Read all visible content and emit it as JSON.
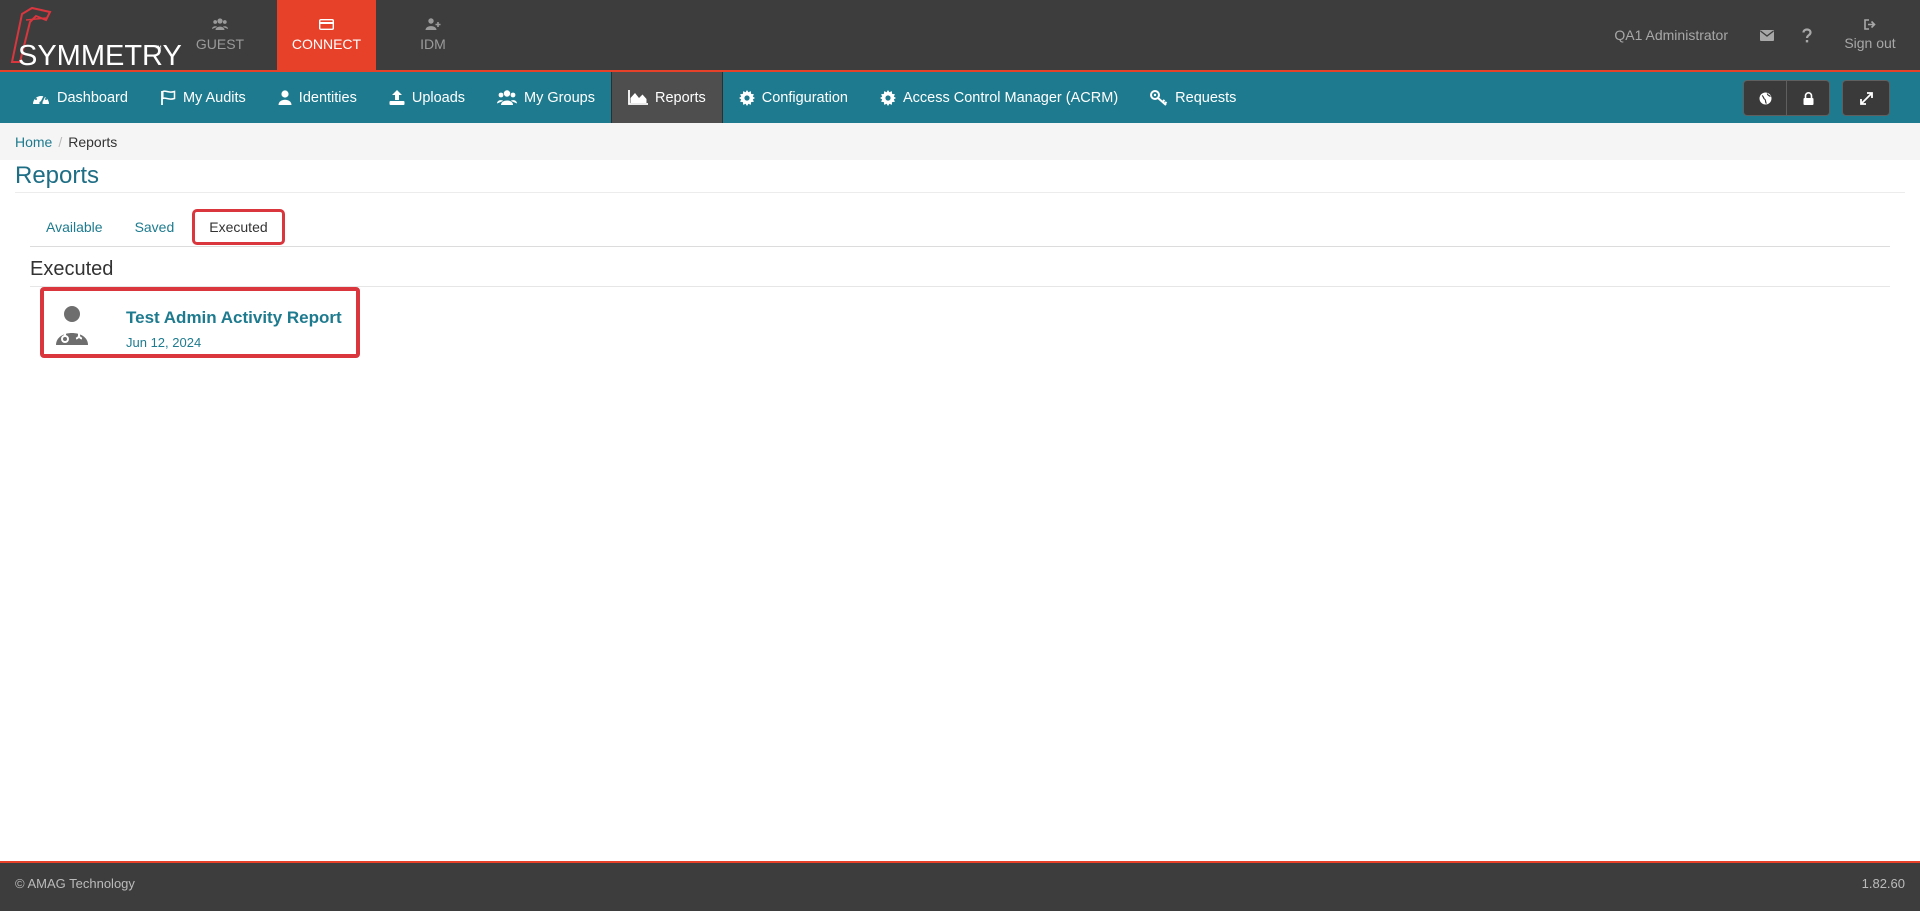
{
  "brand": {
    "name": "SYMMETRY",
    "tm": "™"
  },
  "app_tabs": [
    {
      "label": "GUEST",
      "icon": "users-icon"
    },
    {
      "label": "CONNECT",
      "icon": "card-icon",
      "active": true
    },
    {
      "label": "IDM",
      "icon": "user-plus-icon"
    }
  ],
  "top_right": {
    "user": "QA1 Administrator",
    "sign_out": "Sign out"
  },
  "nav": [
    {
      "label": "Dashboard",
      "icon": "dashboard-icon"
    },
    {
      "label": "My Audits",
      "icon": "flag-icon"
    },
    {
      "label": "Identities",
      "icon": "user-icon"
    },
    {
      "label": "Uploads",
      "icon": "upload-icon"
    },
    {
      "label": "My Groups",
      "icon": "users-icon"
    },
    {
      "label": "Reports",
      "icon": "area-chart-icon",
      "active": true
    },
    {
      "label": "Configuration",
      "icon": "gear-icon"
    },
    {
      "label": "Access Control Manager (ACRM)",
      "icon": "gear-icon"
    },
    {
      "label": "Requests",
      "icon": "key-icon"
    }
  ],
  "breadcrumb": {
    "home": "Home",
    "separator": "/",
    "current": "Reports"
  },
  "page": {
    "title": "Reports"
  },
  "tabs": [
    {
      "label": "Available"
    },
    {
      "label": "Saved"
    },
    {
      "label": "Executed",
      "active": true
    }
  ],
  "section": {
    "title": "Executed"
  },
  "reports": [
    {
      "name": "Test Admin Activity Report",
      "date": "Jun 12, 2024",
      "icon": "user-doctor-icon"
    }
  ],
  "footer": {
    "copyright": "© AMAG Technology",
    "version": "1.82.60"
  },
  "colors": {
    "topbar": "#3d3d3d",
    "accent_red": "#e8412a",
    "nav_teal": "#1e7b8f",
    "highlight": "#d9363e"
  }
}
